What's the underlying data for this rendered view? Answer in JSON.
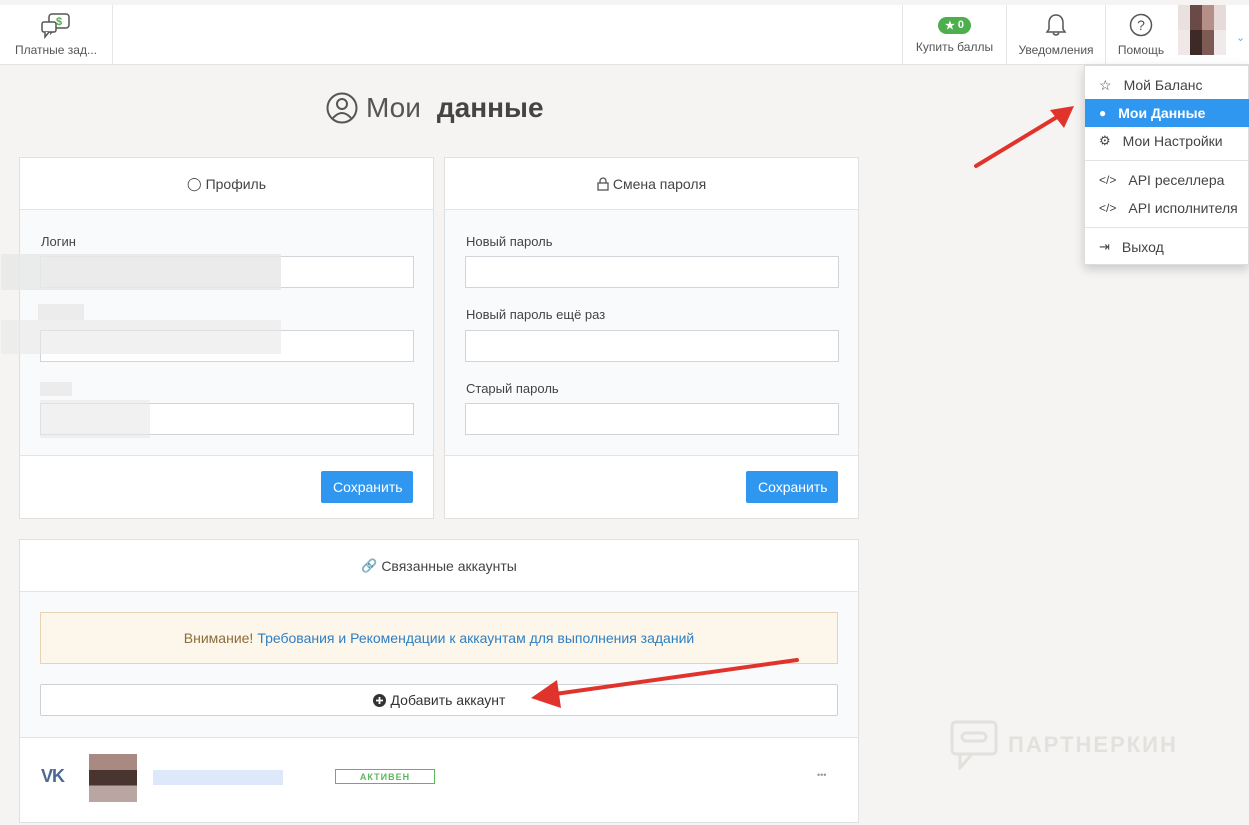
{
  "nav": {
    "paid_tasks_label": "Платные зад...",
    "buy_points_label": "Купить баллы",
    "points_count": "0",
    "notifications_label": "Уведомления",
    "help_label": "Помощь"
  },
  "page": {
    "title_light": "Мои",
    "title_bold": "данные"
  },
  "profile": {
    "header": "Профиль",
    "login_label": "Логин",
    "save_label": "Сохранить"
  },
  "password": {
    "header": "Смена пароля",
    "new_label": "Новый пароль",
    "repeat_label": "Новый пароль ещё раз",
    "old_label": "Старый пароль",
    "save_label": "Сохранить"
  },
  "linked": {
    "header": "Связанные аккаунты",
    "alert_warning": "Внимание!",
    "alert_link": "Требования и Рекомендации к аккаунтам для выполнения заданий",
    "add_account_label": "Добавить аккаунт",
    "account_status": "АКТИВЕН",
    "network_label": "VK",
    "more_label": "•••"
  },
  "dropdown": {
    "items": [
      {
        "label": "Мой Баланс",
        "icon": "star-icon"
      },
      {
        "label": "Мои Данные",
        "icon": "user-circle-icon"
      },
      {
        "label": "Мои Настройки",
        "icon": "gears-icon"
      },
      {
        "label": "API реселлера",
        "icon": "code-icon"
      },
      {
        "label": "API исполнителя",
        "icon": "code-icon"
      },
      {
        "label": "Выход",
        "icon": "sign-out-icon"
      }
    ]
  },
  "watermark": "ПАРТНЕРКИН",
  "colors": {
    "primary": "#2f97f0",
    "success": "#4cae4c",
    "arrow": "#e0332b"
  }
}
